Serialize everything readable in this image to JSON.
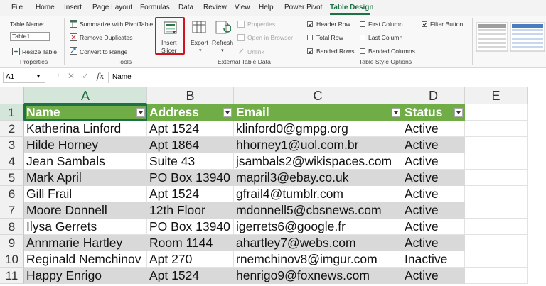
{
  "menu": {
    "tabs": [
      "File",
      "Home",
      "Insert",
      "Page Layout",
      "Formulas",
      "Data",
      "Review",
      "View",
      "Help",
      "Power Pivot",
      "Table Design"
    ],
    "active_tab": "Table Design"
  },
  "ribbon": {
    "properties": {
      "table_name_label": "Table Name:",
      "table_name_value": "Table1",
      "resize_table": "Resize Table",
      "group_label": "Properties"
    },
    "tools": {
      "summarize": "Summarize with PivotTable",
      "remove_duplicates": "Remove Duplicates",
      "convert_to_range": "Convert to Range",
      "insert_slicer_line1": "Insert",
      "insert_slicer_line2": "Slicer",
      "group_label": "Tools"
    },
    "external": {
      "export": "Export",
      "refresh": "Refresh",
      "properties": "Properties",
      "open_in_browser": "Open in Browser",
      "unlink": "Unlink",
      "group_label": "External Table Data"
    },
    "style_options": {
      "header_row": "Header Row",
      "total_row": "Total Row",
      "banded_rows": "Banded Rows",
      "first_column": "First Column",
      "last_column": "Last Column",
      "banded_columns": "Banded Columns",
      "filter_button": "Filter Button",
      "group_label": "Table Style Options"
    },
    "accent_color": "#1e7145",
    "highlight_color": "#d0131c"
  },
  "formula_bar": {
    "name_box": "A1",
    "fx": "fx",
    "content": "Name"
  },
  "sheet": {
    "columns": [
      "A",
      "B",
      "C",
      "D",
      "E"
    ],
    "row_numbers": [
      "1",
      "2",
      "3",
      "4",
      "5",
      "6",
      "7",
      "8",
      "9",
      "10",
      "11"
    ],
    "headers": [
      "Name",
      "Address",
      "Email",
      "Status"
    ],
    "rows": [
      [
        "Katherina Linford",
        "Apt 1524",
        "klinford0@gmpg.org",
        "Active"
      ],
      [
        "Hilde Horney",
        "Apt 1864",
        "hhorney1@uol.com.br",
        "Active"
      ],
      [
        "Jean Sambals",
        "Suite 43",
        "jsambals2@wikispaces.com",
        "Active"
      ],
      [
        "Mark April",
        "PO Box 13940",
        "mapril3@ebay.co.uk",
        "Active"
      ],
      [
        "Gill Frail",
        "Apt 1524",
        "gfrail4@tumblr.com",
        "Active"
      ],
      [
        "Moore Donnell",
        "12th Floor",
        "mdonnell5@cbsnews.com",
        "Active"
      ],
      [
        "Ilysa Gerrets",
        "PO Box 13940",
        "igerrets6@google.fr",
        "Active"
      ],
      [
        "Annmarie Hartley",
        "Room 1144",
        "ahartley7@webs.com",
        "Active"
      ],
      [
        "Reginald Nemchinov",
        "Apt 270",
        "rnemchinov8@imgur.com",
        "Inactive"
      ],
      [
        "Happy Enrigo",
        "Apt 1524",
        "henrigo9@foxnews.com",
        "Active"
      ]
    ],
    "header_color": "#70ad47",
    "band_color": "#d9d9d9"
  }
}
